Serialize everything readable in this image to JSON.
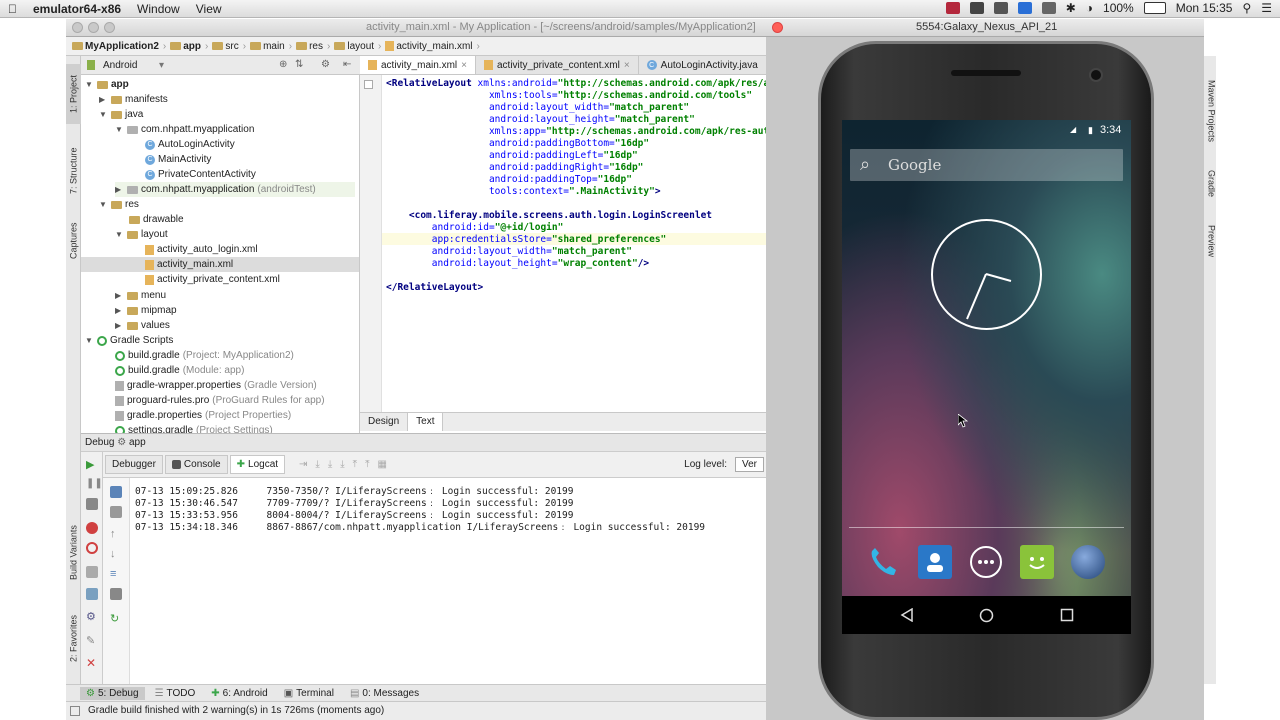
{
  "menubar": {
    "app_name": "emulator64-x86",
    "items": [
      "Window",
      "View"
    ],
    "battery": "100%",
    "clock": "Mon 15:35"
  },
  "ide": {
    "window_title": "activity_main.xml - My Application - [~/screens/android/samples/MyApplication2]",
    "breadcrumbs": [
      "MyApplication2",
      "app",
      "src",
      "main",
      "res",
      "layout",
      "activity_main.xml"
    ],
    "left_tabs": [
      "1: Project",
      "7: Structure",
      "Captures",
      "Build Variants",
      "2: Favorites"
    ],
    "right_tabs": [
      "Maven Projects",
      "Gradle",
      "Preview"
    ],
    "project_view": "Android",
    "tree": [
      {
        "label": "app",
        "bold": true
      },
      {
        "label": "manifests"
      },
      {
        "label": "java"
      },
      {
        "label": "com.nhpatt.myapplication"
      },
      {
        "label": "AutoLoginActivity"
      },
      {
        "label": "MainActivity"
      },
      {
        "label": "PrivateContentActivity"
      },
      {
        "label": "com.nhpatt.myapplication",
        "suffix": "(androidTest)"
      },
      {
        "label": "res"
      },
      {
        "label": "drawable"
      },
      {
        "label": "layout"
      },
      {
        "label": "activity_auto_login.xml"
      },
      {
        "label": "activity_main.xml"
      },
      {
        "label": "activity_private_content.xml"
      },
      {
        "label": "menu"
      },
      {
        "label": "mipmap"
      },
      {
        "label": "values"
      },
      {
        "label": "Gradle Scripts"
      },
      {
        "label": "build.gradle",
        "suffix": "(Project: MyApplication2)"
      },
      {
        "label": "build.gradle",
        "suffix": "(Module: app)"
      },
      {
        "label": "gradle-wrapper.properties",
        "suffix": "(Gradle Version)"
      },
      {
        "label": "proguard-rules.pro",
        "suffix": "(ProGuard Rules for app)"
      },
      {
        "label": "gradle.properties",
        "suffix": "(Project Properties)"
      },
      {
        "label": "settings.gradle",
        "suffix": "(Project Settings)"
      }
    ],
    "editor_tabs": [
      "activity_main.xml",
      "activity_private_content.xml",
      "AutoLoginActivity.java"
    ],
    "code": [
      {
        "tag": "<RelativeLayout",
        "attr": " xmlns:android=",
        "val": "\"http://schemas.android.com/apk/res/android\""
      },
      {
        "indent": "                  ",
        "attr": "xmlns:tools=",
        "val": "\"http://schemas.android.com/tools\""
      },
      {
        "indent": "                  ",
        "attr": "android:layout_width=",
        "val": "\"match_parent\""
      },
      {
        "indent": "                  ",
        "attr": "android:layout_height=",
        "val": "\"match_parent\""
      },
      {
        "indent": "                  ",
        "attr": "xmlns:app=",
        "val": "\"http://schemas.android.com/apk/res-auto\""
      },
      {
        "indent": "                  ",
        "attr": "android:paddingBottom=",
        "val": "\"16dp\""
      },
      {
        "indent": "                  ",
        "attr": "android:paddingLeft=",
        "val": "\"16dp\""
      },
      {
        "indent": "                  ",
        "attr": "android:paddingRight=",
        "val": "\"16dp\""
      },
      {
        "indent": "                  ",
        "attr": "android:paddingTop=",
        "val": "\"16dp\""
      },
      {
        "indent": "                  ",
        "attr": "tools:context=",
        "val": "\".MainActivity\"",
        "tail": ">"
      },
      {
        "indent": ""
      },
      {
        "indent": "    ",
        "tag": "<com.liferay.mobile.screens.auth.login.LoginScreenlet"
      },
      {
        "indent": "        ",
        "attr": "android:id=",
        "val": "\"@+id/login\""
      },
      {
        "indent": "        ",
        "attr": "app:credentialsStore=",
        "val": "\"shared_preferences\""
      },
      {
        "indent": "        ",
        "attr": "android:layout_width=",
        "val": "\"match_parent\""
      },
      {
        "indent": "        ",
        "attr": "android:layout_height=",
        "val": "\"wrap_content\"",
        "tail": "/>"
      },
      {
        "indent": ""
      },
      {
        "tag": "</RelativeLayout>"
      }
    ],
    "design_tabs": [
      "Design",
      "Text"
    ],
    "debug_header": "Debug",
    "debug_app": "app",
    "debug_tabs": [
      "Debugger",
      "Console",
      "Logcat"
    ],
    "log_level_label": "Log level:",
    "log_level_value": "Ver",
    "logs": [
      "07-13 15:09:25.826     7350-7350/? I/LiferayScreens﹕ Login successful: 20199",
      "07-13 15:30:46.547     7709-7709/? I/LiferayScreens﹕ Login successful: 20199",
      "07-13 15:33:53.956     8004-8004/? I/LiferayScreens﹕ Login successful: 20199",
      "07-13 15:34:18.346     8867-8867/com.nhpatt.myapplication I/LiferayScreens﹕ Login successful: 20199"
    ],
    "bottom_tabs": [
      "5: Debug",
      "TODO",
      "6: Android",
      "Terminal",
      "0: Messages"
    ],
    "status": "Gradle build finished with 2 warning(s) in 1s 726ms (moments ago)"
  },
  "emulator": {
    "title": "5554:Galaxy_Nexus_API_21",
    "time": "3:34",
    "search_placeholder": "Google"
  }
}
